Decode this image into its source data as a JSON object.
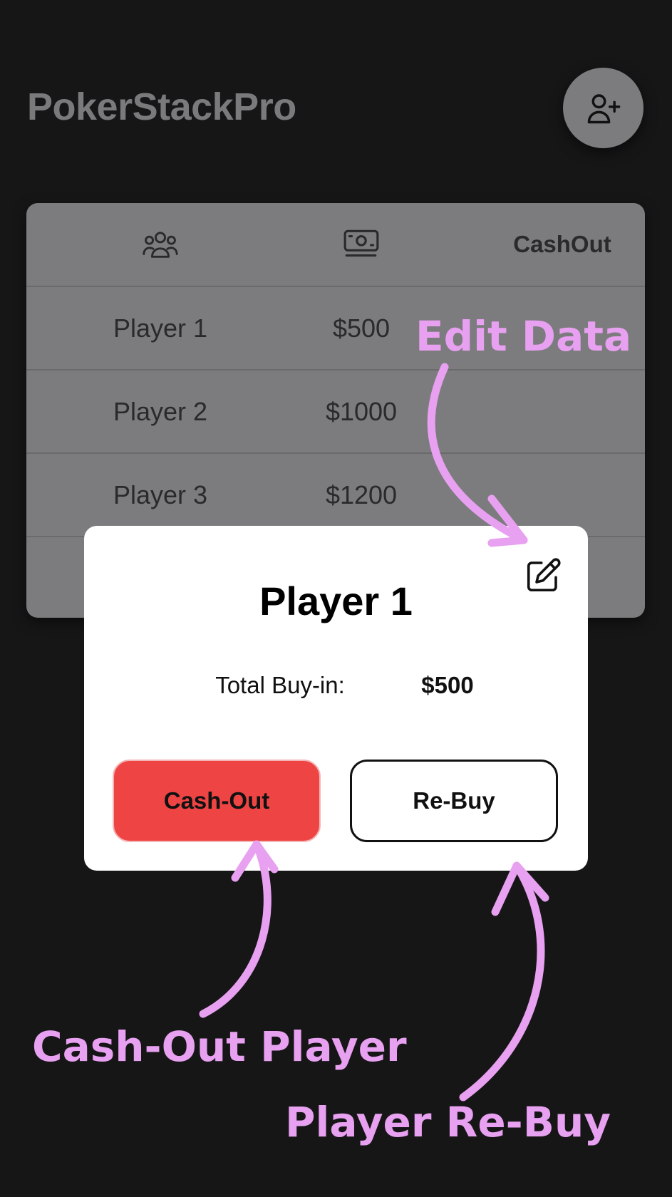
{
  "app": {
    "title": "PokerStackPro"
  },
  "header": {
    "add_player_icon": "user-plus-icon"
  },
  "table": {
    "columns": [
      {
        "icon": "players-group-icon"
      },
      {
        "icon": "money-icon"
      },
      {
        "label": "CashOut"
      }
    ],
    "rows": [
      {
        "player": "Player 1",
        "buyin": "$500",
        "cashout": ""
      },
      {
        "player": "Player 2",
        "buyin": "$1000",
        "cashout": ""
      },
      {
        "player": "Player 3",
        "buyin": "$1200",
        "cashout": ""
      }
    ]
  },
  "modal": {
    "title": "Player 1",
    "buyin_label": "Total Buy-in:",
    "buyin_value": "$500",
    "cashout_button": "Cash-Out",
    "rebuy_button": "Re-Buy",
    "edit_icon": "pencil-edit-icon"
  },
  "annotations": {
    "edit": "Edit Data",
    "cashout": "Cash-Out Player",
    "rebuy": "Player Re-Buy"
  },
  "colors": {
    "background": "#161617",
    "card": "#7c7c7f",
    "danger": "#ef4444",
    "annotation": "#e8a0f0"
  }
}
